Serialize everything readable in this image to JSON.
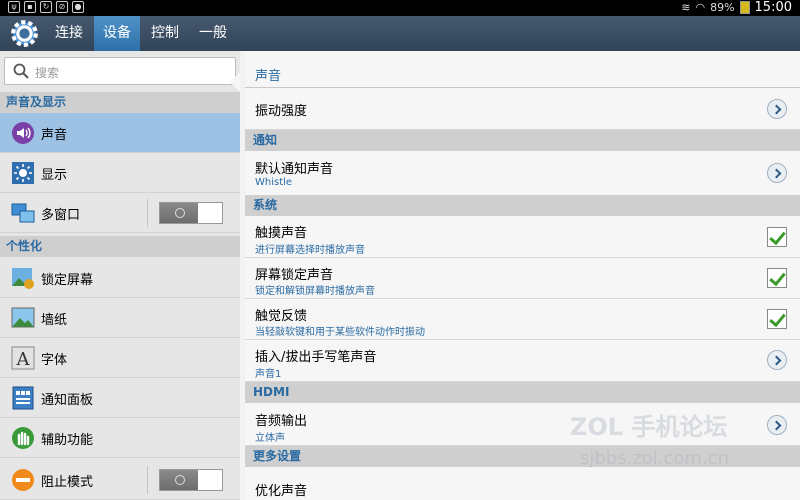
{
  "status_bar": {
    "battery": "89%",
    "time": "15:00"
  },
  "tabs": [
    {
      "label": "连接"
    },
    {
      "label": "设备"
    },
    {
      "label": "控制"
    },
    {
      "label": "一般"
    }
  ],
  "search": {
    "placeholder": "搜索"
  },
  "sidebar": {
    "sections": [
      {
        "header": "声音及显示",
        "items": [
          {
            "label": "声音",
            "icon": "speaker-icon"
          },
          {
            "label": "显示",
            "icon": "brightness-icon"
          },
          {
            "label": "多窗口",
            "icon": "multi-window-icon"
          }
        ]
      },
      {
        "header": "个性化",
        "items": [
          {
            "label": "锁定屏幕",
            "icon": "lock-screen-icon"
          },
          {
            "label": "墙纸",
            "icon": "wallpaper-icon"
          },
          {
            "label": "字体",
            "icon": "font-icon"
          },
          {
            "label": "通知面板",
            "icon": "notification-panel-icon"
          },
          {
            "label": "辅助功能",
            "icon": "accessibility-icon"
          },
          {
            "label": "阻止模式",
            "icon": "blocking-mode-icon"
          }
        ]
      }
    ]
  },
  "panel": {
    "title": "声音",
    "vibration": "振动强度",
    "notification_header": "通知",
    "default_notification": {
      "title": "默认通知声音",
      "sub": "Whistle"
    },
    "system_header": "系统",
    "touch_sound": {
      "title": "触摸声音",
      "sub": "进行屏幕选择时播放声音",
      "checked": true
    },
    "lock_sound": {
      "title": "屏幕锁定声音",
      "sub": "锁定和解锁屏幕时播放声音",
      "checked": true
    },
    "haptic": {
      "title": "触觉反馈",
      "sub": "当轻敲软键和用于某些软件动作时振动",
      "checked": true
    },
    "pen_sound": {
      "title": "插入/拔出手写笔声音",
      "sub": "声音1"
    },
    "hdmi_header": "HDMI",
    "audio_output": {
      "title": "音频输出",
      "sub": "立体声"
    },
    "more_header": "更多设置",
    "optimize_sound": "优化声音"
  },
  "watermark": {
    "line1": "ZOL 手机论坛",
    "line2": "sjbbs.zol.com.cn"
  }
}
